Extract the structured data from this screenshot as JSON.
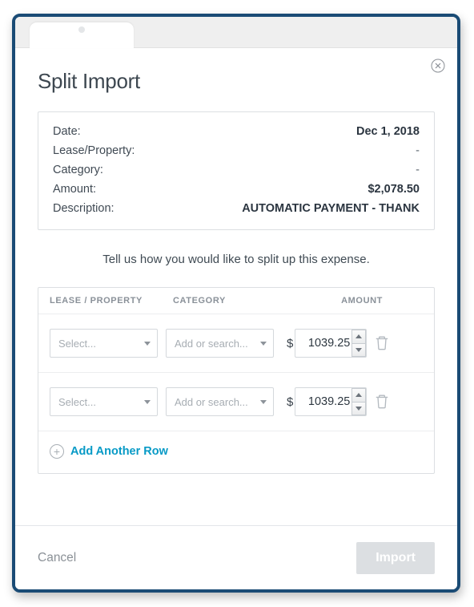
{
  "title": "Split Import",
  "summary": {
    "labels": {
      "date": "Date:",
      "lease": "Lease/Property:",
      "category": "Category:",
      "amount": "Amount:",
      "description": "Description:"
    },
    "values": {
      "date": "Dec 1, 2018",
      "lease": "-",
      "category": "-",
      "amount": "$2,078.50",
      "description": "AUTOMATIC PAYMENT - THANK"
    }
  },
  "instruction": "Tell us how you would like to split up this expense.",
  "columns": {
    "lease": "LEASE / PROPERTY",
    "category": "CATEGORY",
    "amount": "AMOUNT"
  },
  "placeholders": {
    "select": "Select...",
    "category": "Add or search..."
  },
  "currency_symbol": "$",
  "rows": [
    {
      "amount": "1039.25"
    },
    {
      "amount": "1039.25"
    }
  ],
  "add_row_label": "Add Another Row",
  "footer": {
    "cancel": "Cancel",
    "import": "Import"
  }
}
